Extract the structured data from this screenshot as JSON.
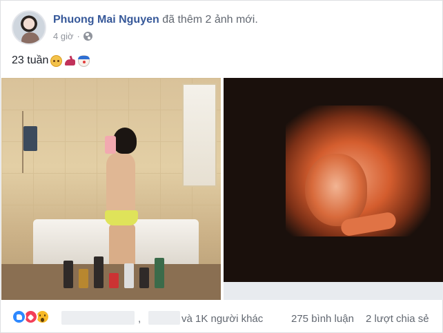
{
  "post": {
    "author_name": "Phuong Mai Nguyen",
    "action_text": " đã thêm 2 ảnh mới.",
    "timestamp": "4 giờ",
    "privacy_icon": "globe-icon",
    "text": "23 tuần",
    "emojis": [
      "cat-emoji",
      "high-heel-emoji",
      "clown-emoji"
    ]
  },
  "photos": [
    {
      "name": "bathroom-mirror-selfie"
    },
    {
      "name": "ultrasound-3d-image"
    }
  ],
  "footer": {
    "reactions": [
      "like-icon",
      "love-icon",
      "wow-icon"
    ],
    "separator": ",",
    "others_text": "và 1K người khác",
    "comments_text": "275 bình luận",
    "shares_text": "2 lượt chia sẻ"
  },
  "colors": {
    "author_link": "#365899",
    "meta_gray": "#90949c",
    "like_blue": "#2d88ff",
    "love_red": "#f33e58",
    "wow_yellow": "#f7b928"
  }
}
